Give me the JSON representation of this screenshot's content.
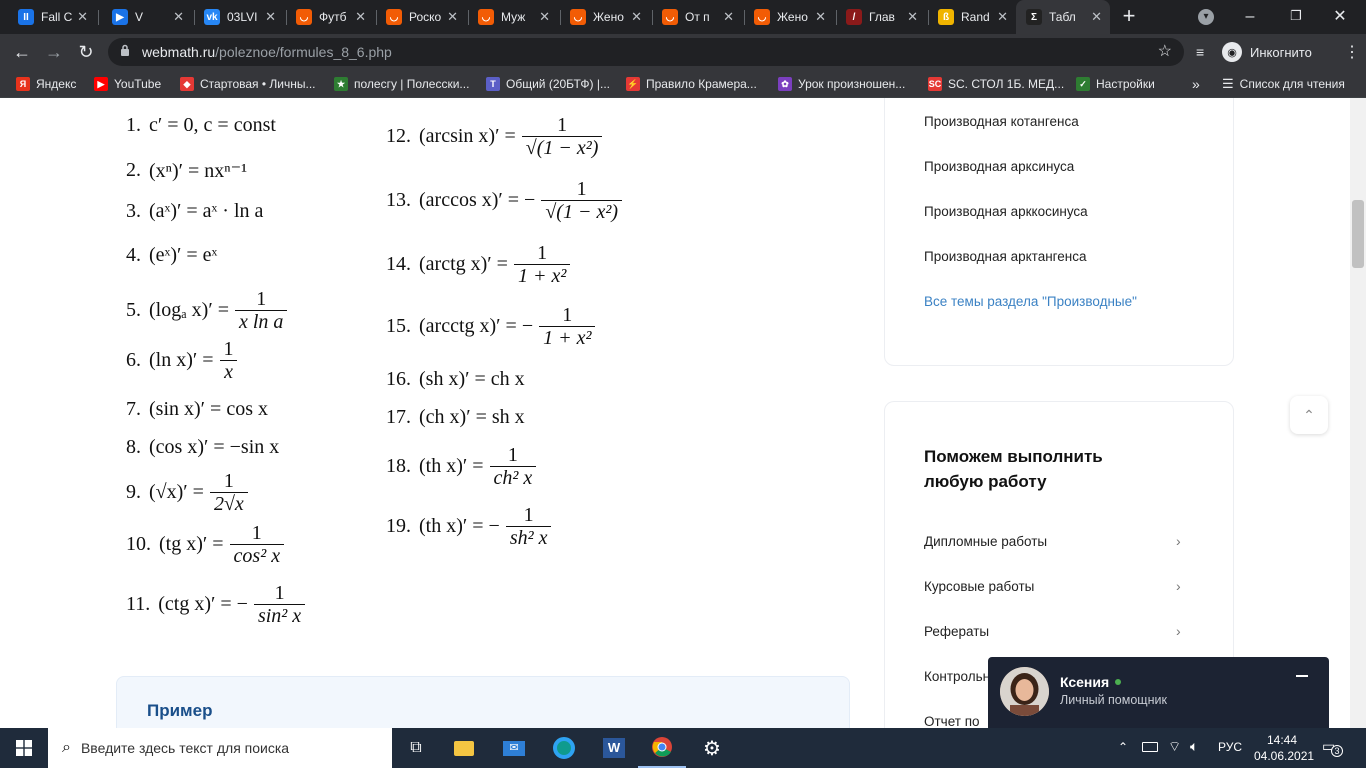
{
  "tabs": [
    {
      "title": "Fall C",
      "icon": "pause-icon",
      "color": "#1a73e8",
      "glyph": "II"
    },
    {
      "title": "V",
      "icon": "video-icon",
      "color": "#1a73e8",
      "glyph": "▶"
    },
    {
      "title": "03LVI",
      "icon": "vk-icon",
      "color": "#2787f5",
      "glyph": "vk"
    },
    {
      "title": "Футб",
      "icon": "shop-icon",
      "color": "#f25c05",
      "glyph": "◡"
    },
    {
      "title": "Роско",
      "icon": "shop-icon",
      "color": "#f25c05",
      "glyph": "◡"
    },
    {
      "title": "Муж",
      "icon": "shop-icon",
      "color": "#f25c05",
      "glyph": "◡"
    },
    {
      "title": "Жено",
      "icon": "shop-icon",
      "color": "#f25c05",
      "glyph": "◡"
    },
    {
      "title": "От п",
      "icon": "shop-icon",
      "color": "#f25c05",
      "glyph": "◡"
    },
    {
      "title": "Жено",
      "icon": "shop-icon",
      "color": "#f25c05",
      "glyph": "◡"
    },
    {
      "title": "Глав",
      "icon": "pen-icon",
      "color": "#8b1a1a",
      "glyph": "/"
    },
    {
      "title": "Rand",
      "icon": "rand-icon",
      "color": "#f0b400",
      "glyph": "ß"
    },
    {
      "title": "Табл",
      "icon": "sigma-icon",
      "color": "#222222",
      "glyph": "Σ"
    }
  ],
  "url": {
    "host": "webmath.ru",
    "path": "/poleznoe/formules_8_6.php"
  },
  "profile_label": "Инкогнито",
  "bookmarks": [
    {
      "label": "Яндекс",
      "color": "#e8331c",
      "glyph": "Я"
    },
    {
      "label": "YouTube",
      "color": "#ff0000",
      "glyph": "▶"
    },
    {
      "label": "Стартовая • Личны...",
      "color": "#e53935",
      "glyph": "◆"
    },
    {
      "label": "полесгу | Полесски...",
      "color": "#2e7d32",
      "glyph": "★"
    },
    {
      "label": "Общий (20БТФ) |...",
      "color": "#5b5fc7",
      "glyph": "T"
    },
    {
      "label": "Правило Крамера...",
      "color": "#e53935",
      "glyph": "⚡"
    },
    {
      "label": "Урок произношен...",
      "color": "#7b3fbf",
      "glyph": "✿"
    },
    {
      "label": "SC. СТОЛ 1Б. МЕД...",
      "color": "#e53935",
      "glyph": "SC"
    },
    {
      "label": "Настройки",
      "color": "#2e7d32",
      "glyph": "✓"
    }
  ],
  "reading_list": "Список для чтения",
  "formulas_left": [
    {
      "n": "1.",
      "expr": "c′ = 0, c = const"
    },
    {
      "n": "2.",
      "expr": "(xⁿ)′ = nxⁿ⁻¹"
    },
    {
      "n": "3.",
      "expr": "(aˣ)′ = aˣ · ln a"
    },
    {
      "n": "4.",
      "expr": "(eˣ)′ = eˣ"
    },
    {
      "n": "5.",
      "lhs": "(logₐ x)′ =",
      "num": "1",
      "den": "x ln a"
    },
    {
      "n": "6.",
      "lhs": "(ln x)′ =",
      "num": "1",
      "den": "x"
    },
    {
      "n": "7.",
      "expr": "(sin x)′ = cos x"
    },
    {
      "n": "8.",
      "expr": "(cos x)′ = −sin x"
    },
    {
      "n": "9.",
      "lhs": "(√x)′ =",
      "num": "1",
      "den": "2√x"
    },
    {
      "n": "10.",
      "lhs": "(tg x)′ =",
      "num": "1",
      "den": "cos² x"
    },
    {
      "n": "11.",
      "lhs": "(ctg x)′ = −",
      "num": "1",
      "den": "sin² x"
    }
  ],
  "formulas_right": [
    {
      "n": "12.",
      "lhs": "(arcsin x)′ =",
      "num": "1",
      "den": "√(1 − x²)"
    },
    {
      "n": "13.",
      "lhs": "(arccos x)′ = −",
      "num": "1",
      "den": "√(1 − x²)"
    },
    {
      "n": "14.",
      "lhs": "(arctg x)′ =",
      "num": "1",
      "den": "1 + x²"
    },
    {
      "n": "15.",
      "lhs": "(arcctg x)′ = −",
      "num": "1",
      "den": "1 + x²"
    },
    {
      "n": "16.",
      "expr": "(sh x)′ = ch x"
    },
    {
      "n": "17.",
      "expr": "(ch x)′ = sh x"
    },
    {
      "n": "18.",
      "lhs": "(th x)′ =",
      "num": "1",
      "den": "ch² x"
    },
    {
      "n": "19.",
      "lhs": "(th x)′ = −",
      "num": "1",
      "den": "sh² x"
    }
  ],
  "example_title": "Пример",
  "sidebar_links": [
    "Производная котангенса",
    "Производная арксинуса",
    "Производная арккосинуса",
    "Производная арктангенса"
  ],
  "sidebar_all_link": "Все темы раздела \"Производные\"",
  "help": {
    "title_line1": "Поможем выполнить",
    "title_line2": "любую работу",
    "items": [
      "Дипломные работы",
      "Курсовые работы",
      "Рефераты",
      "Контрольные",
      "Отчет по"
    ]
  },
  "chat": {
    "name": "Ксения",
    "role": "Личный помощник",
    "status_color": "#4caf50"
  },
  "taskbar": {
    "search_placeholder": "Введите здесь текст для поиска",
    "lang": "РУС",
    "time": "14:44",
    "date": "04.06.2021",
    "notifications": "3"
  }
}
